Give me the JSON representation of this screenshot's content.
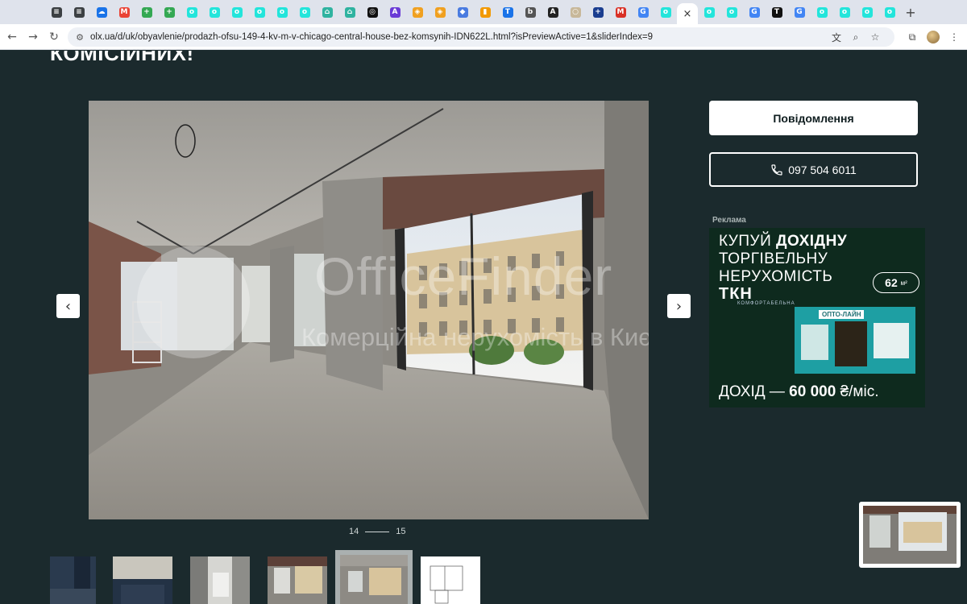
{
  "browser": {
    "tabs": [
      {
        "icon": "notes-icon",
        "color": "#3c4043",
        "glyph": "≡"
      },
      {
        "icon": "notes-icon",
        "color": "#3c4043",
        "glyph": "≡"
      },
      {
        "icon": "cloud-icon",
        "color": "#1a73e8",
        "glyph": "☁"
      },
      {
        "icon": "gmail-icon",
        "color": "#ea4335",
        "glyph": "M"
      },
      {
        "icon": "sheets-plus-icon",
        "color": "#34a853",
        "glyph": "+"
      },
      {
        "icon": "sheets-plus-icon",
        "color": "#34a853",
        "glyph": "+"
      },
      {
        "icon": "olx-icon",
        "color": "#23e5db",
        "glyph": "o"
      },
      {
        "icon": "olx-icon",
        "color": "#23e5db",
        "glyph": "o"
      },
      {
        "icon": "olx-icon",
        "color": "#23e5db",
        "glyph": "o"
      },
      {
        "icon": "olx-icon",
        "color": "#23e5db",
        "glyph": "o"
      },
      {
        "icon": "olx-icon",
        "color": "#23e5db",
        "glyph": "o"
      },
      {
        "icon": "olx-icon",
        "color": "#23e5db",
        "glyph": "o"
      },
      {
        "icon": "home-icon",
        "color": "#2fb3a0",
        "glyph": "⌂"
      },
      {
        "icon": "home-icon",
        "color": "#2fb3a0",
        "glyph": "⌂"
      },
      {
        "icon": "target-icon",
        "color": "#111111",
        "glyph": "◎"
      },
      {
        "icon": "app-icon",
        "color": "#6a3bd6",
        "glyph": "A"
      },
      {
        "icon": "box-icon",
        "color": "#f0a020",
        "glyph": "◈"
      },
      {
        "icon": "box-icon",
        "color": "#f0a020",
        "glyph": "◈"
      },
      {
        "icon": "diamond-icon",
        "color": "#4a7be0",
        "glyph": "◆"
      },
      {
        "icon": "chart-icon",
        "color": "#f29900",
        "glyph": "▮"
      },
      {
        "icon": "translate-icon",
        "color": "#1a73e8",
        "glyph": "T"
      },
      {
        "icon": "b-icon",
        "color": "#555555",
        "glyph": "b"
      },
      {
        "icon": "font-icon",
        "color": "#222222",
        "glyph": "A"
      },
      {
        "icon": "circle-icon",
        "color": "#c8b89a",
        "glyph": "○"
      },
      {
        "icon": "plus-square-icon",
        "color": "#1a3d8f",
        "glyph": "+"
      },
      {
        "icon": "mail-icon",
        "color": "#d93025",
        "glyph": "M"
      },
      {
        "icon": "google-icon",
        "color": "#4285f4",
        "glyph": "G"
      },
      {
        "icon": "olx-icon",
        "color": "#23e5db",
        "glyph": "o"
      },
      {
        "icon": "close-icon",
        "color": "#ffffff",
        "glyph": "×",
        "active": true
      },
      {
        "icon": "olx-icon",
        "color": "#23e5db",
        "glyph": "o"
      },
      {
        "icon": "olx-icon",
        "color": "#23e5db",
        "glyph": "o"
      },
      {
        "icon": "google-icon",
        "color": "#4285f4",
        "glyph": "G"
      },
      {
        "icon": "t-icon",
        "color": "#111111",
        "glyph": "T"
      },
      {
        "icon": "google-icon",
        "color": "#4285f4",
        "glyph": "G"
      },
      {
        "icon": "olx-icon",
        "color": "#23e5db",
        "glyph": "o"
      },
      {
        "icon": "olx-icon",
        "color": "#23e5db",
        "glyph": "o"
      },
      {
        "icon": "olx-icon",
        "color": "#23e5db",
        "glyph": "o"
      },
      {
        "icon": "olx-icon",
        "color": "#23e5db",
        "glyph": "o"
      }
    ],
    "new_tab_glyph": "+",
    "url": "olx.ua/d/uk/obyavlenie/prodazh-ofsu-149-4-kv-m-v-chicago-central-house-bez-komsynih-IDN622L.html?isPreviewActive=1&sliderIndex=9"
  },
  "listing": {
    "title_fragment": "КОМІСІЙНИХ!",
    "gallery": {
      "current": "14",
      "total": "15",
      "prev_glyph": "‹",
      "next_glyph": "›",
      "watermark_title": "OfficeFinder",
      "watermark_subtitle": "Комерційна нерухомість в Києві"
    },
    "actions": {
      "message_label": "Повідомлення",
      "phone_label": "097 504 6011"
    }
  },
  "ad": {
    "label": "Реклама",
    "line1_a": "КУПУЙ ",
    "line1_b": "ДОХІДНУ",
    "line2": "ТОРГІВЕЛЬНУ",
    "line3": "НЕРУХОМІСТЬ",
    "size_value": "62",
    "size_unit": "м²",
    "brand": "ТКН",
    "brand_sub": "КОМФОРТАБЕЛЬНА",
    "shop_name": "ОПТО-ЛАЙН",
    "income_a": "ДОХІД — ",
    "income_b": "60 000",
    "income_c": " ₴/міс."
  },
  "colors": {
    "page_bg": "#1b2a2d",
    "button_bg": "#ffffff",
    "ad_bg": "#0e2a1e",
    "olx_accent": "#23e5db"
  }
}
